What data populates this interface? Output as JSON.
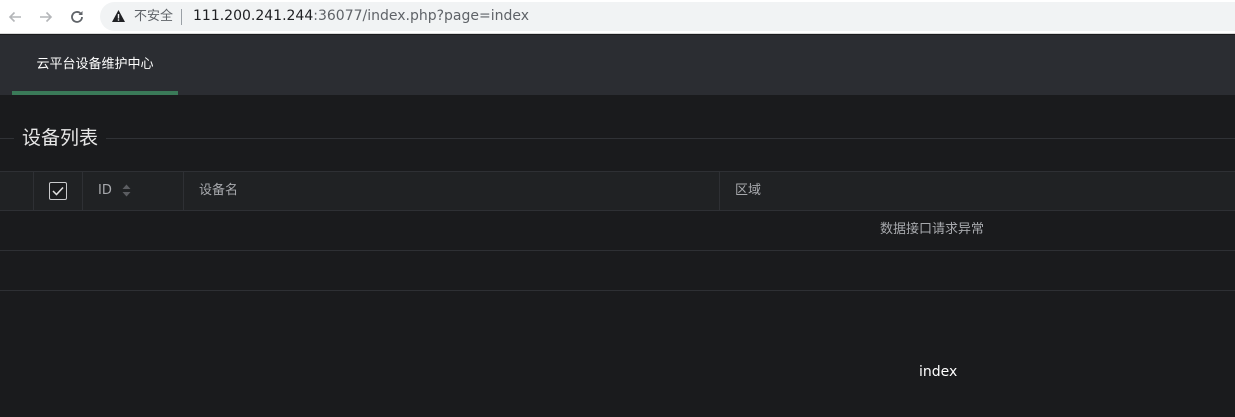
{
  "browser": {
    "security_label": "不安全",
    "url_host": "111.200.241.244",
    "url_rest": ":36077/index.php?page=index"
  },
  "header": {
    "brand": "云平台设备维护中心",
    "accent_color": "#3a7a58"
  },
  "section": {
    "title": "设备列表"
  },
  "table": {
    "columns": [
      "ID",
      "设备名",
      "区域"
    ],
    "select_all_checked": true,
    "empty_message": "数据接口请求异常"
  },
  "footer": {
    "page_label": "index"
  }
}
